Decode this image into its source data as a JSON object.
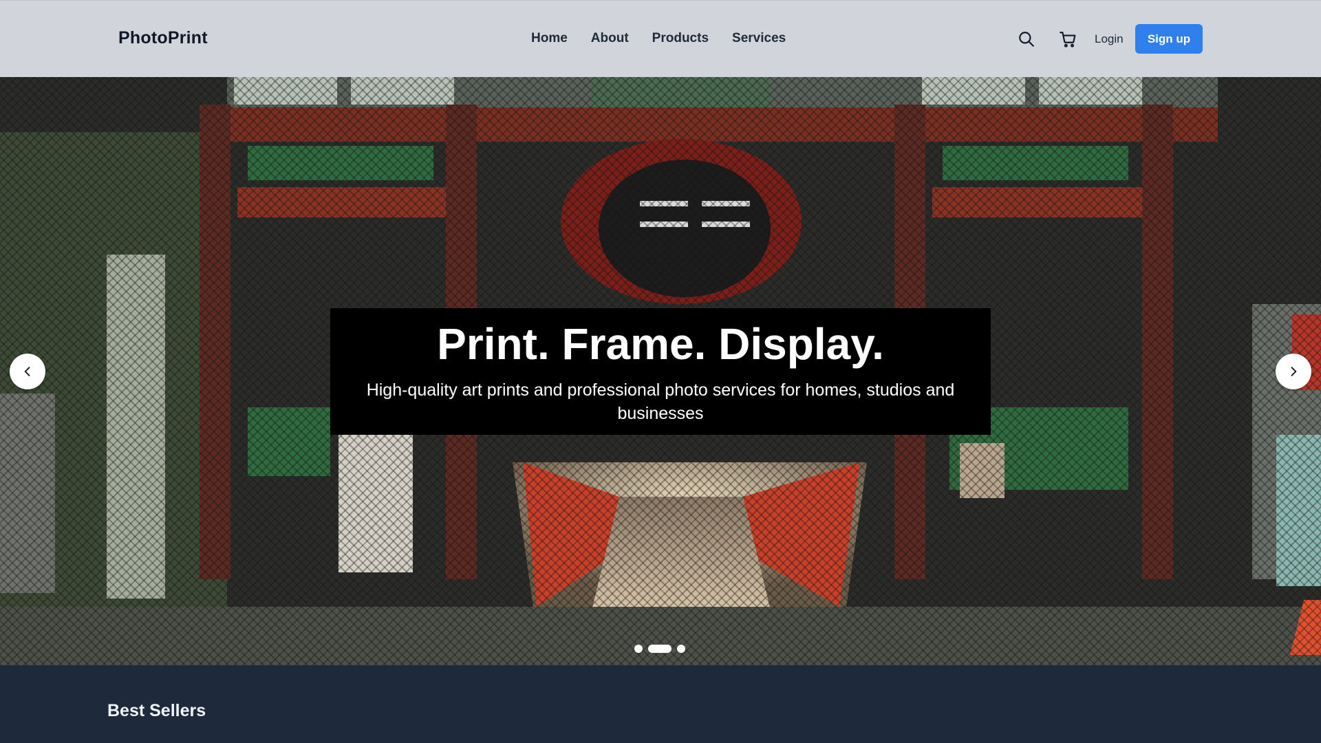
{
  "brand": {
    "name": "PhotoPrint"
  },
  "nav": {
    "items": [
      {
        "label": "Home"
      },
      {
        "label": "About"
      },
      {
        "label": "Products"
      },
      {
        "label": "Services"
      }
    ]
  },
  "header_actions": {
    "search_icon": "search-icon",
    "cart_icon": "cart-icon",
    "login_label": "Login",
    "signup_label": "Sign up",
    "signup_color": "#2f80ed"
  },
  "hero": {
    "title": "Print. Frame. Display.",
    "subtitle": "High-quality art prints and professional photo services for homes, studios and businesses",
    "slide_count": 3,
    "active_slide": 2,
    "prev_icon": "chevron-left-icon",
    "next_icon": "chevron-right-icon"
  },
  "sections": {
    "best_sellers_title": "Best Sellers"
  }
}
